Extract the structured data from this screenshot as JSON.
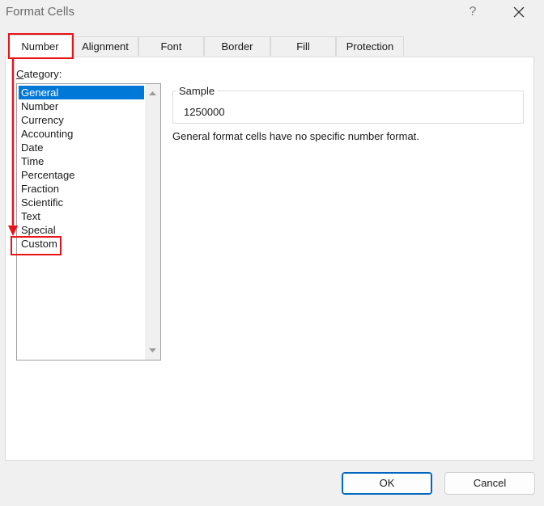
{
  "window": {
    "title": "Format Cells",
    "help_label": "?",
    "close_icon": "close-icon"
  },
  "tabs": [
    {
      "label": "Number",
      "active": true
    },
    {
      "label": "Alignment",
      "active": false
    },
    {
      "label": "Font",
      "active": false
    },
    {
      "label": "Border",
      "active": false
    },
    {
      "label": "Fill",
      "active": false
    },
    {
      "label": "Protection",
      "active": false
    }
  ],
  "category": {
    "label_accel": "C",
    "label_rest": "ategory:",
    "items": [
      {
        "label": "General",
        "selected": true
      },
      {
        "label": "Number",
        "selected": false
      },
      {
        "label": "Currency",
        "selected": false
      },
      {
        "label": "Accounting",
        "selected": false
      },
      {
        "label": "Date",
        "selected": false
      },
      {
        "label": "Time",
        "selected": false
      },
      {
        "label": "Percentage",
        "selected": false
      },
      {
        "label": "Fraction",
        "selected": false
      },
      {
        "label": "Scientific",
        "selected": false
      },
      {
        "label": "Text",
        "selected": false
      },
      {
        "label": "Special",
        "selected": false
      },
      {
        "label": "Custom",
        "selected": false
      }
    ]
  },
  "sample": {
    "label": "Sample",
    "value": "1250000"
  },
  "description": "General format cells have no specific number format.",
  "buttons": {
    "ok": "OK",
    "cancel": "Cancel"
  },
  "colors": {
    "selection": "#0078d7",
    "annotation": "#e8141a",
    "ok_border": "#0067c0"
  }
}
